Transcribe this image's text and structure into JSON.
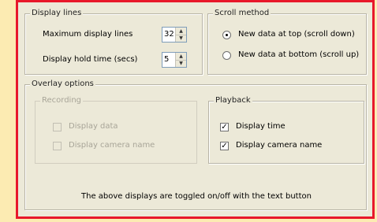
{
  "display_lines": {
    "title": "Display lines",
    "max_lines_label": "Maximum display lines",
    "max_lines_value": "32",
    "hold_time_label": "Display hold time (secs)",
    "hold_time_value": "5"
  },
  "scroll_method": {
    "title": "Scroll method",
    "options": [
      {
        "label": "New data at top (scroll down)",
        "selected": true
      },
      {
        "label": "New data at bottom (scroll up)",
        "selected": false
      }
    ]
  },
  "overlay": {
    "title": "Overlay options",
    "recording": {
      "title": "Recording",
      "display_data_label": "Display data",
      "display_camera_label": "Display camera name"
    },
    "playback": {
      "title": "Playback",
      "display_time_label": "Display time",
      "display_camera_label": "Display camera name"
    },
    "note": "The above displays are toggled on/off with the text button"
  },
  "spin_up_glyph": "▲",
  "spin_down_glyph": "▼",
  "check_glyph": "✓",
  "colors": {
    "page_bg": "#FCEBB2",
    "frame_border": "#E8182A",
    "dialog_bg": "#ECE9D8"
  }
}
